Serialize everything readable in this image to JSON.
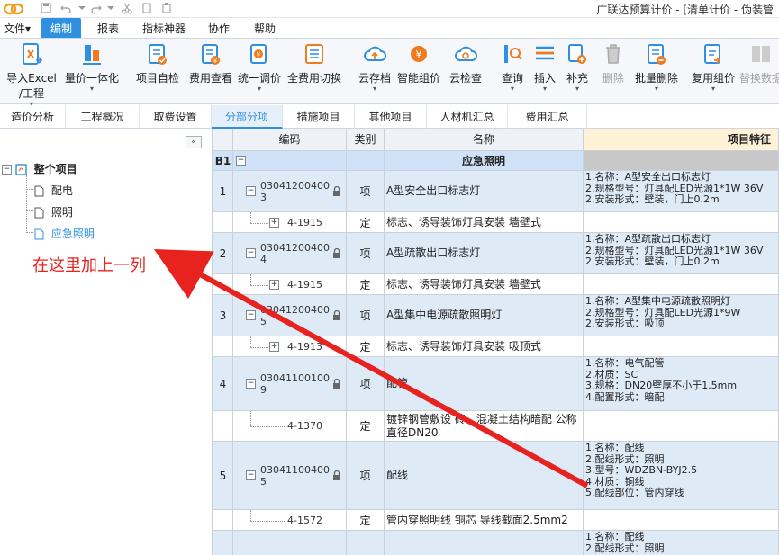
{
  "titlebar": {
    "title": "广联达预算计价 - [清单计价 - 伪装管"
  },
  "menu": [
    {
      "label": "文件▾",
      "active": false
    },
    {
      "label": "编制",
      "active": true
    },
    {
      "label": "报表",
      "active": false
    },
    {
      "label": "指标神器",
      "active": false
    },
    {
      "label": "协作",
      "active": false
    },
    {
      "label": "帮助",
      "active": false
    }
  ],
  "ribbon": [
    {
      "label": "导入Excel",
      "label2": "/工程",
      "icon": "import-excel-icon",
      "dropdown": true,
      "disabled": false
    },
    {
      "label": "量价一体化",
      "icon": "qty-price-icon",
      "dropdown": true,
      "disabled": false
    },
    {
      "label": "项目自检",
      "icon": "self-check-icon",
      "dropdown": false,
      "disabled": false
    },
    {
      "label": "费用查看",
      "icon": "fee-view-icon",
      "dropdown": false,
      "disabled": false
    },
    {
      "label": "统一调价",
      "icon": "price-adjust-icon",
      "dropdown": true,
      "disabled": false
    },
    {
      "label": "全费用切换",
      "icon": "full-fee-switch-icon",
      "dropdown": false,
      "disabled": false
    },
    {
      "label": "云存档",
      "icon": "cloud-archive-icon",
      "dropdown": true,
      "disabled": false
    },
    {
      "label": "智能组价",
      "icon": "smart-pricing-icon",
      "dropdown": false,
      "disabled": false
    },
    {
      "label": "云检查",
      "icon": "cloud-check-icon",
      "dropdown": false,
      "disabled": false
    },
    {
      "label": "查询",
      "icon": "query-icon",
      "dropdown": true,
      "disabled": false
    },
    {
      "label": "插入",
      "icon": "insert-icon",
      "dropdown": true,
      "disabled": false
    },
    {
      "label": "补充",
      "icon": "supplement-icon",
      "dropdown": true,
      "disabled": false
    },
    {
      "label": "删除",
      "icon": "trash-icon",
      "dropdown": false,
      "disabled": true
    },
    {
      "label": "批量删除",
      "icon": "batch-delete-icon",
      "dropdown": true,
      "disabled": false
    },
    {
      "label": "复用组价",
      "icon": "reuse-pricing-icon",
      "dropdown": true,
      "disabled": false
    },
    {
      "label": "替换数据",
      "icon": "replace-data-icon",
      "dropdown": false,
      "disabled": true
    }
  ],
  "tabs": [
    {
      "label": "造价分析",
      "active": false
    },
    {
      "label": "工程概况",
      "active": false
    },
    {
      "label": "取费设置",
      "active": false
    },
    {
      "label": "分部分项",
      "active": true
    },
    {
      "label": "措施项目",
      "active": false
    },
    {
      "label": "其他项目",
      "active": false
    },
    {
      "label": "人材机汇总",
      "active": false
    },
    {
      "label": "费用汇总",
      "active": false
    }
  ],
  "tree": {
    "collapse_label": "«",
    "root": "整个项目",
    "children": [
      {
        "label": "配电",
        "selected": false
      },
      {
        "label": "照明",
        "selected": false
      },
      {
        "label": "应急照明",
        "selected": true
      }
    ]
  },
  "annotation": "在这里加上一列",
  "grid": {
    "headers": {
      "code": "编码",
      "type": "类别",
      "name": "名称",
      "feature": "项目特征"
    },
    "section": {
      "id": "B1",
      "name": "应急照明"
    },
    "rows": [
      {
        "no": "1",
        "code1": "03041200400",
        "code2": "3",
        "type": "项",
        "name": "A型安全出口标志灯",
        "locked": true,
        "main": true,
        "features": [
          "1.名称：A型安全出口标志灯",
          "2.规格型号：灯具配LED光源1*1W 36V",
          "2.安装形式：壁装，门上0.2m"
        ]
      },
      {
        "no": "",
        "code1": "4-1915",
        "code2": "",
        "type": "定",
        "name": "标志、诱导装饰灯具安装 墙壁式",
        "locked": false,
        "main": false,
        "expand": true,
        "features": []
      },
      {
        "no": "2",
        "code1": "03041200400",
        "code2": "4",
        "type": "项",
        "name": "A型疏散出口标志灯",
        "locked": true,
        "main": true,
        "features": [
          "1.名称：A型疏散出口标志灯",
          "2.规格型号：灯具配LED光源1*1W 36V",
          "2.安装形式：壁装，门上0.2m"
        ]
      },
      {
        "no": "",
        "code1": "4-1915",
        "code2": "",
        "type": "定",
        "name": "标志、诱导装饰灯具安装 墙壁式",
        "locked": false,
        "main": false,
        "expand": true,
        "features": []
      },
      {
        "no": "3",
        "code1": "03041200400",
        "code2": "5",
        "type": "项",
        "name": "A型集中电源疏散照明灯",
        "locked": true,
        "main": true,
        "features": [
          "1.名称：A型集中电源疏散照明灯",
          "2.规格型号：灯具配LED光源1*9W",
          "2.安装形式：吸顶"
        ]
      },
      {
        "no": "",
        "code1": "4-1913",
        "code2": "",
        "type": "定",
        "name": "标志、诱导装饰灯具安装 吸顶式",
        "locked": false,
        "main": false,
        "expand": true,
        "features": []
      },
      {
        "no": "4",
        "code1": "03041100100",
        "code2": "9",
        "type": "项",
        "name": "配管",
        "locked": true,
        "main": true,
        "features": [
          "1.名称：电气配管",
          "2.材质：SC",
          "3.规格：DN20壁厚不小于1.5mm",
          "4.配置形式：暗配"
        ]
      },
      {
        "no": "",
        "code1": "4-1370",
        "code2": "",
        "type": "定",
        "name": "镀锌钢管敷设 砖、混凝土结构暗配 公称直径DN20",
        "locked": false,
        "main": false,
        "expand": false,
        "features": []
      },
      {
        "no": "5",
        "code1": "03041100400",
        "code2": "5",
        "type": "项",
        "name": "配线",
        "locked": true,
        "main": true,
        "features": [
          "1.名称：配线",
          "2.配线形式：照明",
          "3.型号：WDZBN-BYJ2.5",
          "4.材质：铜线",
          "5.配线部位：管内穿线"
        ]
      },
      {
        "no": "",
        "code1": "4-1572",
        "code2": "",
        "type": "定",
        "name": "管内穿照明线 铜芯 导线截面2.5mm2",
        "locked": false,
        "main": false,
        "expand": false,
        "features": []
      },
      {
        "no": "",
        "code1": "",
        "code2": "",
        "type": "",
        "name": "",
        "locked": false,
        "main": true,
        "features": [
          "1.名称：配线",
          "2.配线形式：照明"
        ]
      }
    ]
  },
  "colors": {
    "accent": "#2f8fe0",
    "annotation_red": "#e8231f",
    "row_highlight": "#dfeaf7",
    "feature_header": "#fff2d6"
  }
}
